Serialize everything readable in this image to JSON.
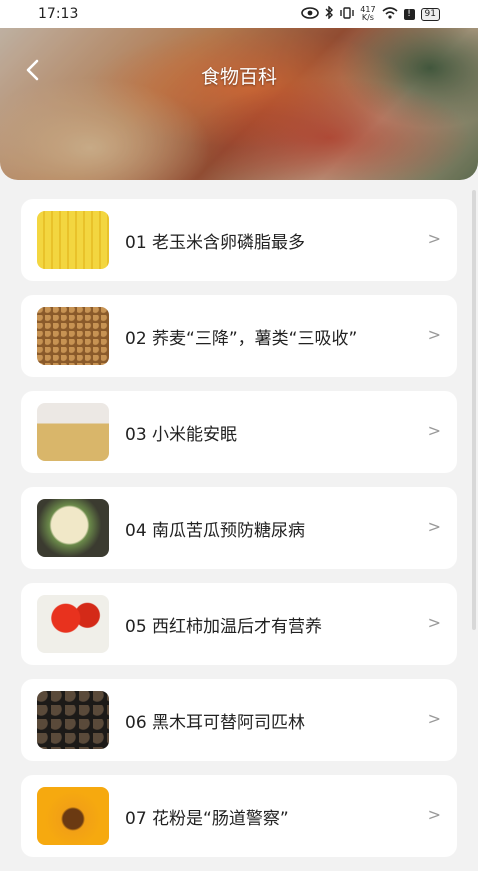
{
  "status_bar": {
    "time": "17:13",
    "net_speed_value": "417",
    "net_speed_unit": "K/s",
    "battery": "91"
  },
  "header": {
    "title": "食物百科"
  },
  "items": [
    {
      "title": "01 老玉米含卵磷脂最多"
    },
    {
      "title": "02 荞麦“三降”，薯类“三吸收”"
    },
    {
      "title": "03 小米能安眠"
    },
    {
      "title": "04 南瓜苦瓜预防糖尿病"
    },
    {
      "title": "05 西红柿加温后才有营养"
    },
    {
      "title": "06 黑木耳可替阿司匹林"
    },
    {
      "title": "07 花粉是“肠道警察”"
    }
  ],
  "chevron": ">"
}
